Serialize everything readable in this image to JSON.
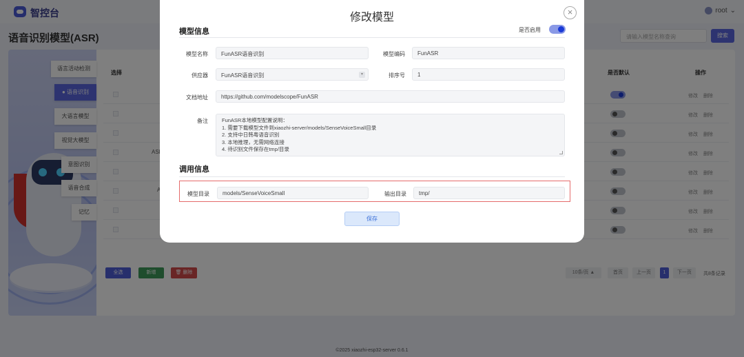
{
  "app": {
    "brand": "智控台",
    "user": "root"
  },
  "page": {
    "title": "语音识别模型(ASR)",
    "search_placeholder": "请输入模型名称查询",
    "search_button": "搜索"
  },
  "tabs": [
    "语言活动检测",
    "语音识别",
    "大语言模型",
    "视觉大模型",
    "意图识别",
    "语音合成",
    "记忆"
  ],
  "table": {
    "headers": {
      "select": "选择",
      "default": "是否默认",
      "actions": "操作"
    },
    "fragments": [
      "ASR",
      "A"
    ],
    "row_default_on": [
      true,
      false,
      false,
      false,
      false,
      false,
      false,
      false
    ],
    "edit_label": "修改",
    "delete_label": "删除"
  },
  "bottom": {
    "select_all": "全选",
    "add": "新增",
    "delete": "删除"
  },
  "pagination": {
    "page_size": "10条/页",
    "first": "首页",
    "prev": "上一页",
    "current": "1",
    "next": "下一页",
    "total": "共8条记录"
  },
  "footer": "©2025 xiaozhi-esp32-server 0.6.1",
  "modal": {
    "title": "修改模型",
    "section_model_info": "模型信息",
    "enabled_label": "是否启用",
    "enabled": true,
    "fields": {
      "model_name_label": "模型名称",
      "model_name": "FunASR语音识别",
      "model_code_label": "模型编码",
      "model_code": "FunASR",
      "supplier_label": "供应器",
      "supplier": "FunASR语音识别",
      "sort_label": "排序号",
      "sort": "1",
      "doc_label": "文档地址",
      "doc_url": "https://github.com/modelscope/FunASR",
      "remark_label": "备注",
      "remark_lines": [
        "FunASR本地模型配置说明：",
        "1. 需要下载模型文件到xiaozhi-server/models/SenseVoiceSmall目录",
        "2. 支持中日韩粤语音识别",
        "3. 本地推理，无需网络连接",
        "4. 待识别文件保存在tmp/目录"
      ]
    },
    "section_call_info": "调用信息",
    "call": {
      "model_dir_label": "模型目录",
      "model_dir": "models/SenseVoiceSmall",
      "output_dir_label": "输出目录",
      "output_dir": "tmp/"
    },
    "save_label": "保存"
  }
}
